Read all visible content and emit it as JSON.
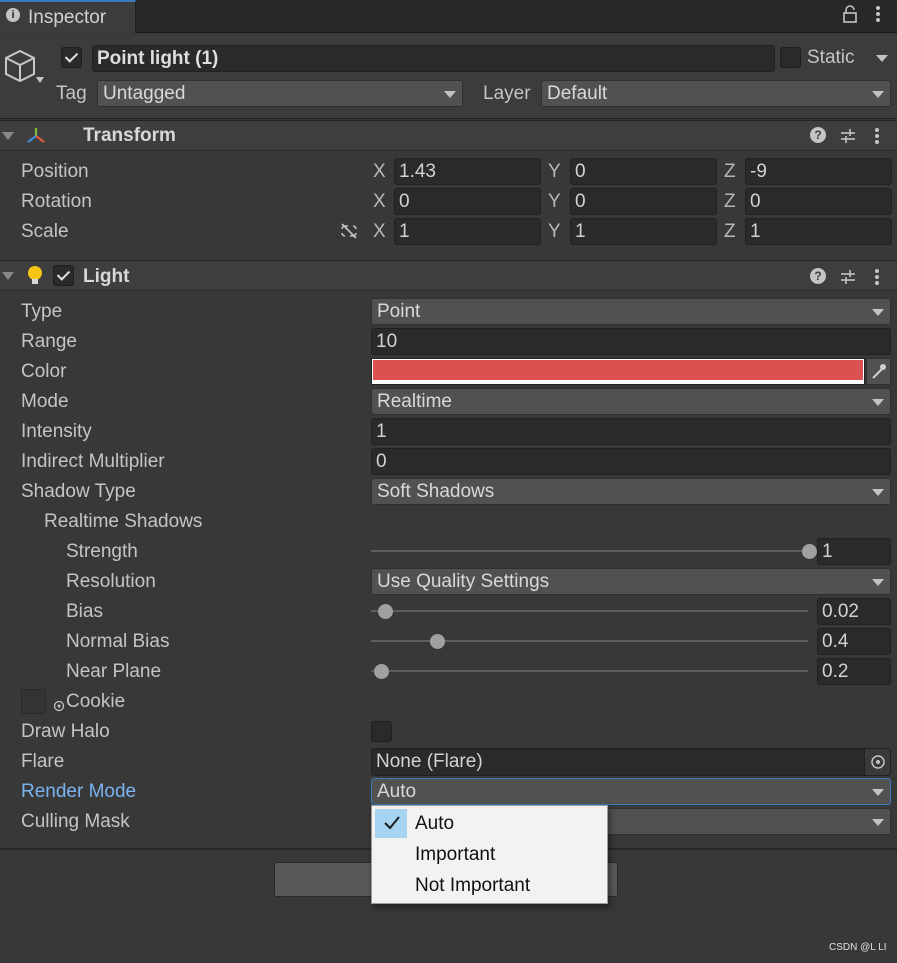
{
  "tab": {
    "title": "Inspector"
  },
  "header": {
    "object_name": "Point light (1)",
    "active_checked": true,
    "static_label": "Static",
    "tag_label": "Tag",
    "tag_value": "Untagged",
    "layer_label": "Layer",
    "layer_value": "Default"
  },
  "transform": {
    "title": "Transform",
    "position": {
      "label": "Position",
      "x": "1.43",
      "y": "0",
      "z": "-9"
    },
    "rotation": {
      "label": "Rotation",
      "x": "0",
      "y": "0",
      "z": "0"
    },
    "scale": {
      "label": "Scale",
      "x": "1",
      "y": "1",
      "z": "1"
    },
    "axis": {
      "x": "X",
      "y": "Y",
      "z": "Z"
    }
  },
  "light": {
    "title": "Light",
    "type": {
      "label": "Type",
      "value": "Point"
    },
    "range": {
      "label": "Range",
      "value": "10"
    },
    "color": {
      "label": "Color",
      "hex": "#db5050"
    },
    "mode": {
      "label": "Mode",
      "value": "Realtime"
    },
    "intensity": {
      "label": "Intensity",
      "value": "1"
    },
    "indirect": {
      "label": "Indirect Multiplier",
      "value": "0"
    },
    "shadow_type": {
      "label": "Shadow Type",
      "value": "Soft Shadows"
    },
    "realtime_shadows": {
      "label": "Realtime Shadows"
    },
    "strength": {
      "label": "Strength",
      "value": "1",
      "fraction": 1.0
    },
    "resolution": {
      "label": "Resolution",
      "value": "Use Quality Settings"
    },
    "bias": {
      "label": "Bias",
      "value": "0.02",
      "fraction": 0.01
    },
    "normal_bias": {
      "label": "Normal Bias",
      "value": "0.4",
      "fraction": 0.13
    },
    "near_plane": {
      "label": "Near Plane",
      "value": "0.2",
      "fraction": 0.0
    },
    "cookie": {
      "label": "Cookie"
    },
    "draw_halo": {
      "label": "Draw Halo"
    },
    "flare": {
      "label": "Flare",
      "value": "None (Flare)"
    },
    "render_mode": {
      "label": "Render Mode",
      "value": "Auto"
    },
    "culling_mask": {
      "label": "Culling Mask"
    }
  },
  "render_mode_menu": {
    "options": [
      "Auto",
      "Important",
      "Not Important"
    ],
    "selected": "Auto"
  },
  "watermark": "CSDN @L LI",
  "colors": {
    "accent_blue": "#7ab4f0",
    "selection": "#a6d4f2"
  }
}
